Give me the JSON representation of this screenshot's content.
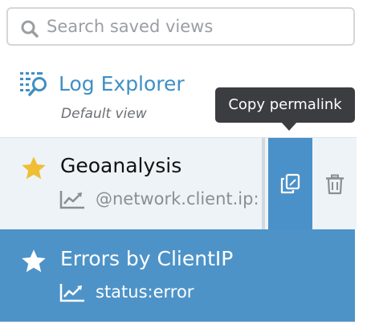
{
  "search": {
    "placeholder": "Search saved views",
    "icon": "search-icon"
  },
  "default_view": {
    "icon": "log-explorer-icon",
    "title": "Log Explorer",
    "subtitle": "Default view"
  },
  "tooltip": {
    "text": "Copy permalink"
  },
  "saved_views": [
    {
      "name": "Geoanalysis",
      "query": "@network.client.ip:",
      "starred": true,
      "star_color": "#f0be33",
      "selected": false
    },
    {
      "name": "Errors by ClientIP",
      "query": "status:error",
      "starred": true,
      "star_color": "#ffffff",
      "selected": true
    }
  ],
  "colors": {
    "accent": "#3f8fc4",
    "selected_row": "#4d93c8",
    "hover_row": "#eef3f7",
    "copy_button": "#4a91c9",
    "tooltip_bg": "#3b3d40"
  },
  "icons": {
    "copy": "copy-permalink-icon",
    "delete": "trash-icon",
    "chart": "chart-line-icon",
    "star": "star-icon"
  }
}
